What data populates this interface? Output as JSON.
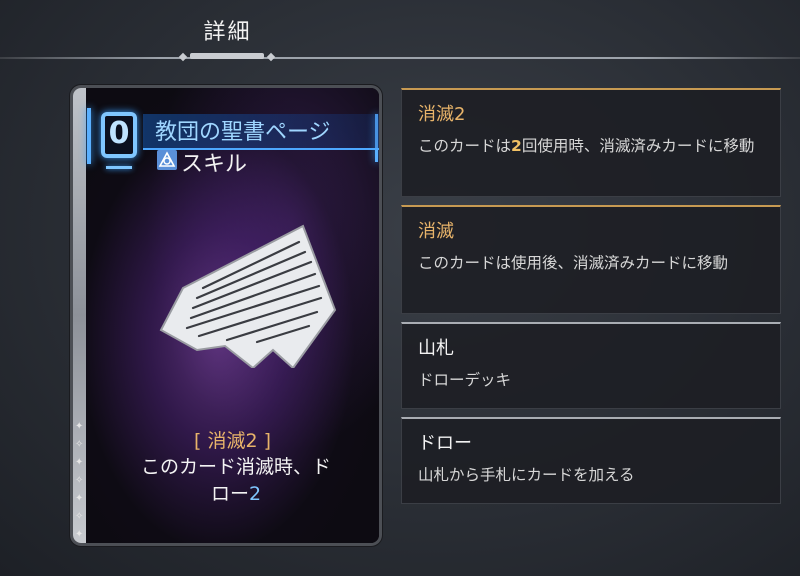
{
  "header": {
    "title": "詳細"
  },
  "card": {
    "cost": "0",
    "name": "教団の聖書ページ",
    "type": "スキル",
    "keyword": "[ 消滅2 ]",
    "desc_part1": "このカード消滅時、ド",
    "desc_part2": "ロー",
    "desc_num": "2"
  },
  "panels": [
    {
      "title": "消滅2",
      "body_pre": "このカードは",
      "body_hl": "2",
      "body_post": "回使用時、消滅済みカードに移動"
    },
    {
      "title": "消滅",
      "body": "このカードは使用後、消滅済みカードに移動"
    },
    {
      "title": "山札",
      "body": "ドローデッキ"
    },
    {
      "title": "ドロー",
      "body": "山札から手札にカードを加える"
    }
  ],
  "colors": {
    "keyword_gold": "#e8b46a",
    "accent_blue": "#7fc6ff",
    "number_highlight": "#f2c265"
  },
  "icons": [
    "skill-type-icon",
    "sparkle-icon"
  ]
}
